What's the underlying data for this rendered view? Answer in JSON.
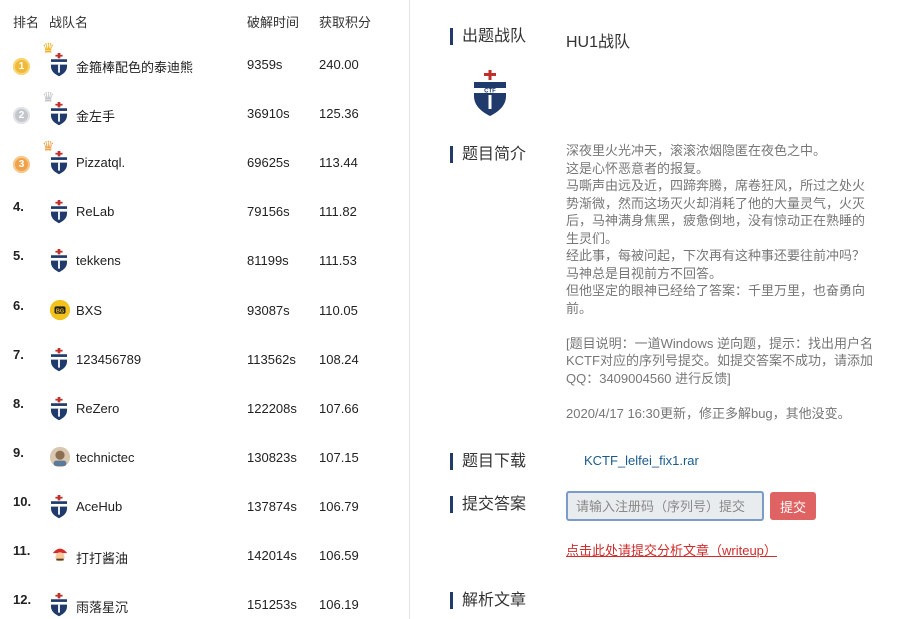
{
  "ranking": {
    "headers": {
      "rank": "排名",
      "team": "战队名",
      "time": "破解时间",
      "score": "获取积分"
    },
    "rows": [
      {
        "rank": "1",
        "medal": "gold",
        "name": "金箍棒配色的泰迪熊",
        "time": "9359s",
        "score": "240.00",
        "avatar": "ctf-shield-icon"
      },
      {
        "rank": "2",
        "medal": "silver",
        "name": "金左手",
        "time": "36910s",
        "score": "125.36",
        "avatar": "ctf-shield-icon"
      },
      {
        "rank": "3",
        "medal": "bronze",
        "name": "Pizzatql.",
        "time": "69625s",
        "score": "113.44",
        "avatar": "ctf-shield-icon"
      },
      {
        "rank": "4.",
        "medal": "",
        "name": "ReLab",
        "time": "79156s",
        "score": "111.82",
        "avatar": "ctf-shield-icon"
      },
      {
        "rank": "5.",
        "medal": "",
        "name": "tekkens",
        "time": "81199s",
        "score": "111.53",
        "avatar": "ctf-shield-icon"
      },
      {
        "rank": "6.",
        "medal": "",
        "name": "BXS",
        "time": "93087s",
        "score": "110.05",
        "avatar": "bxs-logo-icon"
      },
      {
        "rank": "7.",
        "medal": "",
        "name": "123456789",
        "time": "113562s",
        "score": "108.24",
        "avatar": "ctf-shield-icon"
      },
      {
        "rank": "8.",
        "medal": "",
        "name": "ReZero",
        "time": "122208s",
        "score": "107.66",
        "avatar": "ctf-shield-icon"
      },
      {
        "rank": "9.",
        "medal": "",
        "name": "technictec",
        "time": "130823s",
        "score": "107.15",
        "avatar": "photo-avatar-icon"
      },
      {
        "rank": "10.",
        "medal": "",
        "name": "AceHub",
        "time": "137874s",
        "score": "106.79",
        "avatar": "ctf-shield-icon"
      },
      {
        "rank": "11.",
        "medal": "",
        "name": "打打酱油",
        "time": "142014s",
        "score": "106.59",
        "avatar": "mario-avatar-icon"
      },
      {
        "rank": "12.",
        "medal": "",
        "name": "雨落星沉",
        "time": "151253s",
        "score": "106.19",
        "avatar": "ctf-shield-icon"
      }
    ]
  },
  "challenge": {
    "author_label": "出题战队",
    "author_value": "HU1战队",
    "logo_text": "CTF",
    "intro_label": "题目简介",
    "intro_lines": [
      "深夜里火光冲天，滚滚浓烟隐匿在夜色之中。",
      "这是心怀恶意者的报复。",
      "马嘶声由远及近，四蹄奔腾，席卷狂风，所过之处火势渐微，然而这场灭火却消耗了他的大量灵气，火灭后，马神满身焦黑，疲惫倒地，没有惊动正在熟睡的生灵们。",
      "经此事，每被问起，下次再有这种事还要往前冲吗？",
      "马神总是目视前方不回答。",
      "但他坚定的眼神已经给了答案：千里万里，也奋勇向前。"
    ],
    "intro_note": "[题目说明：一道Windows 逆向题，提示：找出用户名KCTF对应的序列号提交。如提交答案不成功，请添加QQ：3409004560 进行反馈]",
    "intro_update": "2020/4/17 16:30更新，修正多解bug，其他没变。",
    "download_label": "题目下载",
    "download_file": "KCTF_lelfei_fix1.rar",
    "answer_label": "提交答案",
    "answer_placeholder": "请输入注册码（序列号）提交",
    "submit_label": "提交",
    "writeup_link": "点击此处请提交分析文章（writeup）",
    "analysis_label": "解析文章"
  },
  "colors": {
    "accent_navy": "#1f3a6b",
    "submit_red": "#e06363",
    "link_red": "#d02c2c",
    "link_blue": "#1a5b8f"
  }
}
